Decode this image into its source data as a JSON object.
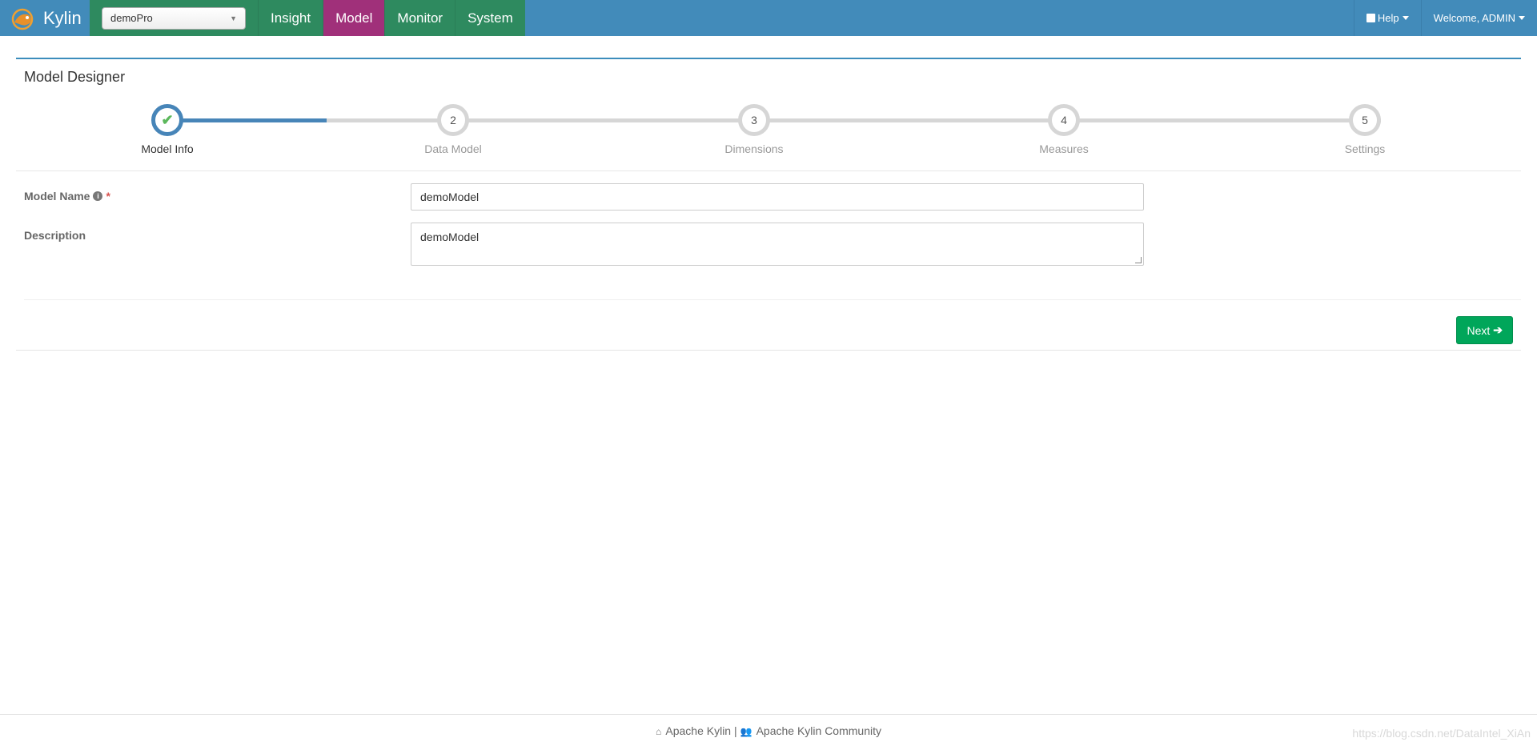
{
  "nav": {
    "brand": "Kylin",
    "project": "demoPro",
    "tabs": [
      {
        "label": "Insight"
      },
      {
        "label": "Model"
      },
      {
        "label": "Monitor"
      },
      {
        "label": "System"
      }
    ],
    "active_tab": "Model",
    "help": "Help",
    "user": "Welcome, ADMIN"
  },
  "panel": {
    "title": "Model Designer"
  },
  "wizard": {
    "steps": [
      {
        "number": "✔",
        "label": "Model Info",
        "done": true
      },
      {
        "number": "2",
        "label": "Data Model",
        "done": false
      },
      {
        "number": "3",
        "label": "Dimensions",
        "done": false
      },
      {
        "number": "4",
        "label": "Measures",
        "done": false
      },
      {
        "number": "5",
        "label": "Settings",
        "done": false
      }
    ]
  },
  "form": {
    "model_name_label": "Model Name",
    "model_name_value": "demoModel",
    "required_mark": "*",
    "description_label": "Description",
    "description_value": "demoModel",
    "next_label": "Next"
  },
  "footer": {
    "link1": "Apache Kylin",
    "separator": "|",
    "link2": "Apache Kylin Community"
  },
  "watermark": "https://blog.csdn.net/DataIntel_XiAn",
  "colors": {
    "topbar": "#428bba",
    "nav_green": "#2e8a5f",
    "nav_active": "#a0307a",
    "next_button": "#00a65a",
    "step_done": "#4785b8"
  }
}
